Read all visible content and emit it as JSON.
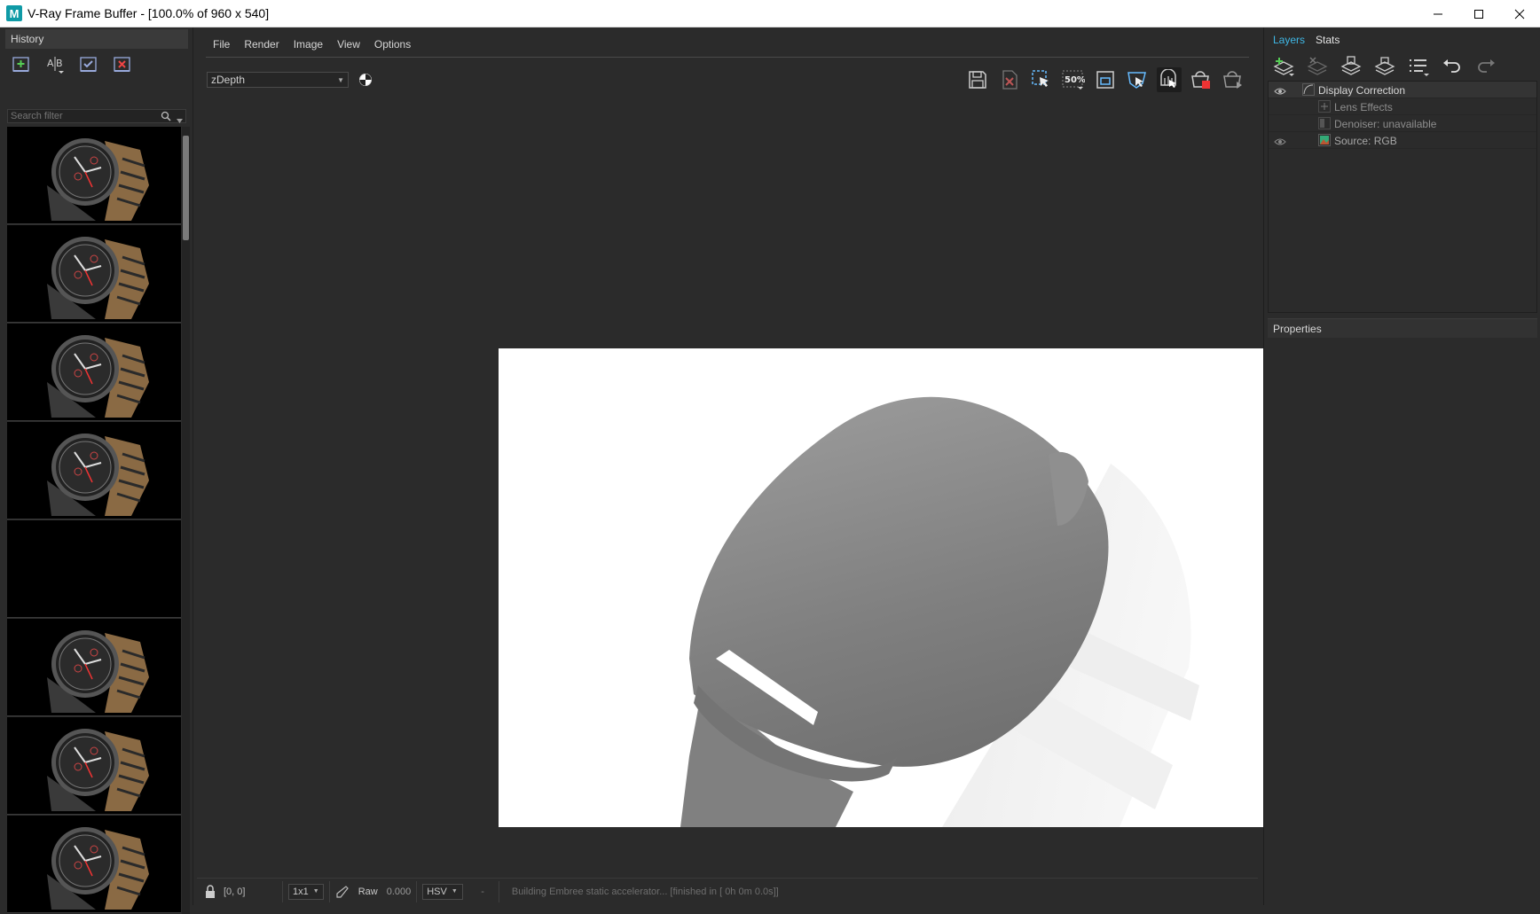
{
  "window": {
    "title": "V-Ray Frame Buffer - [100.0% of 960 x 540]",
    "app_icon_letter": "M",
    "buttons": [
      "minimize-icon",
      "maximize-icon",
      "close-icon"
    ]
  },
  "history": {
    "tab_label": "History",
    "toolbar_icons": [
      "save-to-history-icon",
      "ab-compare-icon",
      "load-history-icon",
      "remove-history-icon"
    ],
    "search_placeholder": "Search filter",
    "thumbnails": [
      {
        "kind": "watch"
      },
      {
        "kind": "watch"
      },
      {
        "kind": "watch"
      },
      {
        "kind": "watch"
      },
      {
        "kind": "empty"
      },
      {
        "kind": "watch"
      },
      {
        "kind": "watch"
      },
      {
        "kind": "watch"
      }
    ]
  },
  "menu": {
    "items": [
      "File",
      "Render",
      "Image",
      "View",
      "Options"
    ]
  },
  "toolbar": {
    "channel": "zDepth",
    "zoom_label": "50%",
    "right_icons": [
      "save-image-icon",
      "clear-image-icon",
      "region-render-icon",
      "zoom-50-icon",
      "fit-window-icon",
      "track-mouse-icon",
      "interactive-render-icon",
      "stop-render-icon",
      "render-icon"
    ]
  },
  "layers_panel": {
    "tabs": [
      "Layers",
      "Stats"
    ],
    "active_tab": "Layers",
    "tool_icons": [
      "add-layer-icon",
      "delete-layer-icon",
      "save-layer-tree-icon",
      "load-layer-tree-icon",
      "layer-presets-icon",
      "undo-icon",
      "redo-icon"
    ],
    "layers": [
      {
        "name": "Display Correction",
        "visible": true,
        "level": 0
      },
      {
        "name": "Lens Effects",
        "visible": false,
        "level": 1
      },
      {
        "name": "Denoiser: unavailable",
        "visible": false,
        "level": 1
      },
      {
        "name": "Source: RGB",
        "visible": true,
        "level": 1
      }
    ],
    "properties_label": "Properties"
  },
  "status": {
    "coords": "[0, 0]",
    "sample_size": "1x1",
    "color_mode": "Raw",
    "pixel_value": "0.000",
    "color_space": "HSV",
    "separator": "-",
    "message": "Building Embree static accelerator... [finished in [ 0h  0m  0.0s]]"
  },
  "colors": {
    "accent_tab": "#3fb8e6",
    "background": "#2b2b2b",
    "render_background": "#ffffff"
  }
}
